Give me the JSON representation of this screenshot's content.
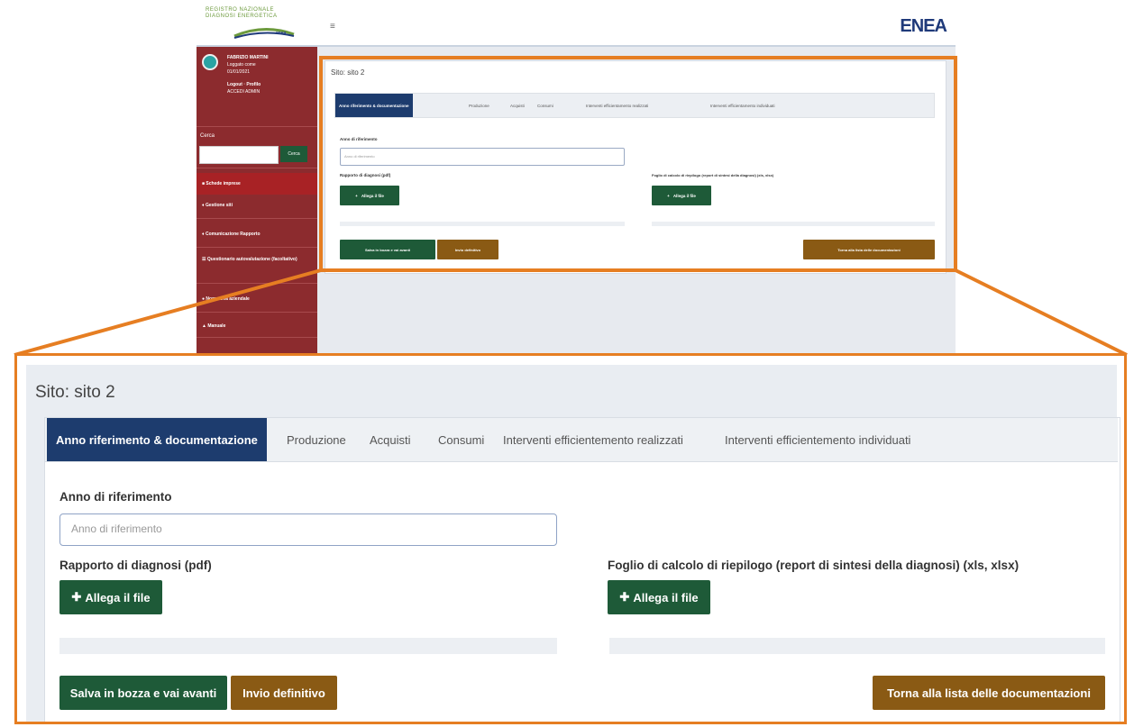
{
  "thumbnail": {
    "logo_text": [
      "Diagnosi Energetica",
      "Registro nazionale"
    ],
    "logo_brand_small": "enea",
    "hamburger_icon": "≡",
    "enea_logo": "ENEA",
    "sidebar": {
      "user_name": "FABRIZIO MARTINI",
      "user_line2": "Loggato come",
      "user_line3": "01/01/2021",
      "user_links": "Logout  ·  Profilo",
      "user_line5": "ACCEDI ADMIN",
      "search_label": "Cerca",
      "search_button": "Cerca",
      "items": [
        "Schede imprese",
        "Gestione siti",
        "Comunicazione Rapporto",
        "Questionario autovalutazione (facoltativo)",
        "Normativa aziendale",
        "Manuale"
      ]
    },
    "panel": {
      "title": "Sito: sito 2",
      "tabs": [
        "Anno riferimento & documentazione",
        "Produzione",
        "Acquisti",
        "Consumi",
        "Interventi efficientamento realizzati",
        "Interventi efficientamento individuati"
      ],
      "anno_label": "Anno di riferimento",
      "anno_placeholder": "Anno di riferimento",
      "rapporto_label": "Rapporto di diagnosi (pdf)",
      "foglio_label": "Foglio di calcolo di riepilogo (report di sintesi della diagnosi) (xls, xlsx)",
      "allega_label": "Allega il file",
      "salva_label": "Salva in bozza e vai avanti",
      "invio_label": "Invio definitivo",
      "torna_label": "Torna alla lista delle documentazioni"
    }
  },
  "zoom": {
    "title": "Sito: sito 2",
    "tabs": [
      "Anno riferimento & documentazione",
      "Produzione",
      "Acquisti",
      "Consumi",
      "Interventi efficientemento realizzati",
      "Interventi efficientemento individuati"
    ],
    "anno_label": "Anno di riferimento",
    "anno_placeholder": "Anno di riferimento",
    "rapporto_label": "Rapporto di diagnosi (pdf)",
    "foglio_label": "Foglio di calcolo di riepilogo (report di sintesi della diagnosi) (xls, xlsx)",
    "allega_label": "Allega il file",
    "salva_label": "Salva in bozza e vai avanti",
    "invio_label": "Invio definitivo",
    "torna_label": "Torna alla lista delle documentazioni"
  },
  "colors": {
    "sidebar": "#8c2b2e",
    "primary_tab": "#1d3c6e",
    "green_button": "#1e5a38",
    "brown_button": "#8a5a14",
    "highlight": "#e67e22"
  }
}
